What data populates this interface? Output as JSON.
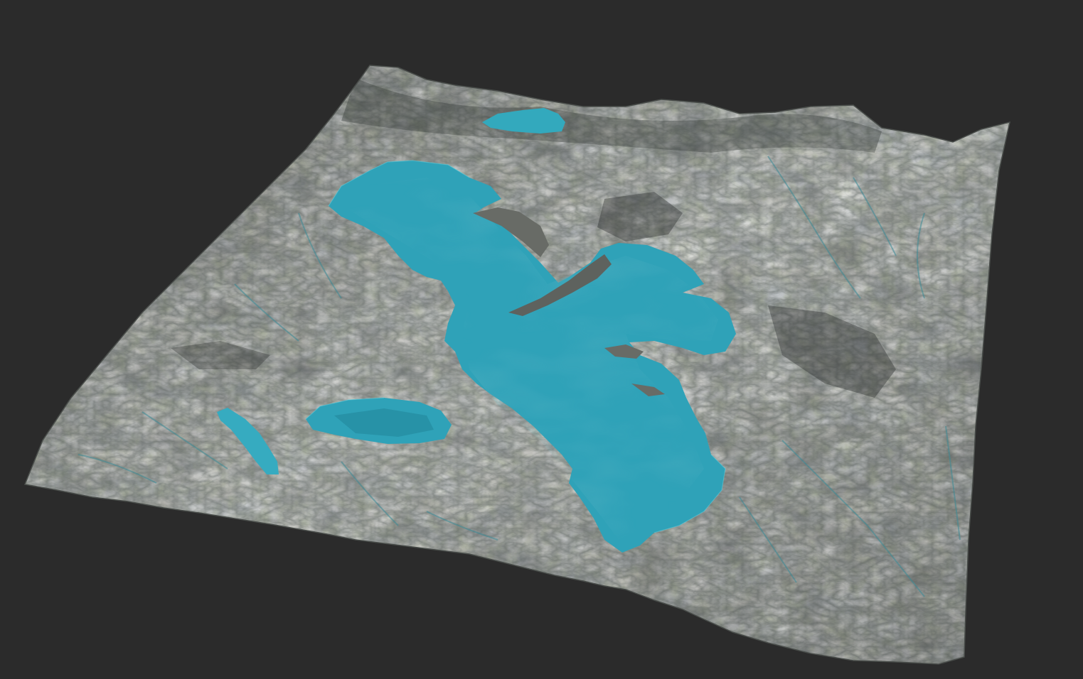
{
  "viewport": {
    "background_color": "#2b2b2b",
    "content": "3d-terrain-render"
  },
  "terrain": {
    "rock_color": "#6f7370",
    "rock_dark_color": "#3a3f3d",
    "rock_light_color": "#a9aca5",
    "vegetation_color": "#5f6a45",
    "water_color": "#2fa2b8",
    "water_deep_color": "#1f7f92",
    "water_light_color": "#46bfd3"
  },
  "water_bodies": [
    {
      "id": "main-lake"
    },
    {
      "id": "northern-pond"
    },
    {
      "id": "western-lake"
    },
    {
      "id": "western-tarn"
    }
  ]
}
